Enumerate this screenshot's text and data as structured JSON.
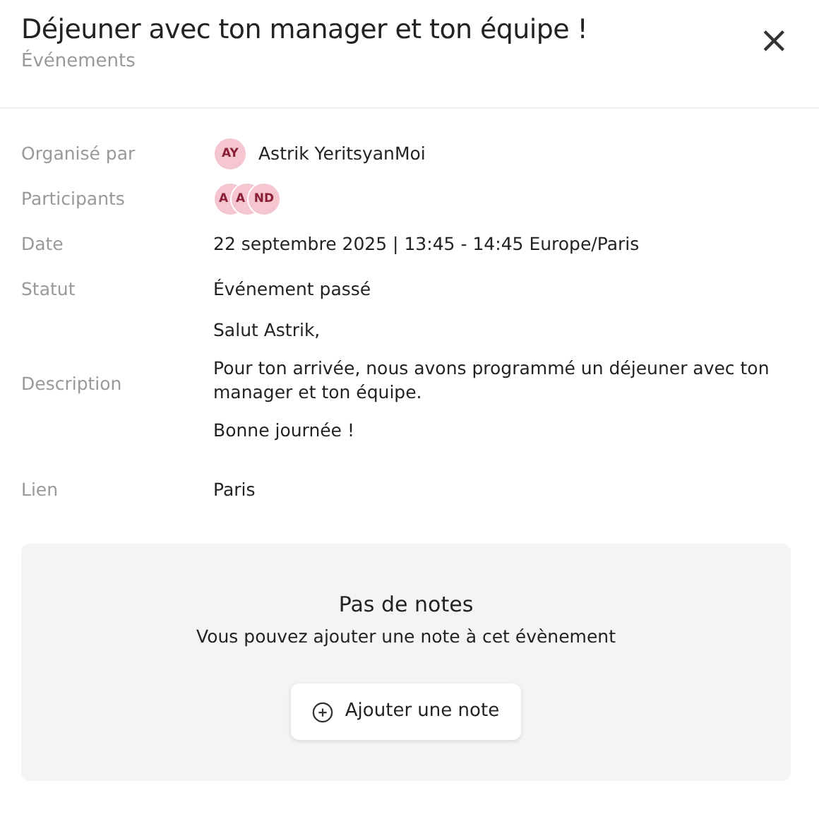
{
  "header": {
    "title": "Déjeuner avec ton manager et ton équipe !",
    "subtitle": "Événements",
    "close": "×"
  },
  "details": [
    {
      "kind": "person",
      "label": "Organisé par",
      "initials": "AY",
      "value": "Astrik YeritsyanMoi"
    },
    {
      "kind": "avatars",
      "label": "Participants",
      "avatars": [
        "A",
        "A",
        "ND"
      ]
    },
    {
      "kind": "text",
      "label": "Date",
      "value": "22 septembre 2025 | 13:45 - 14:45 Europe/Paris"
    },
    {
      "kind": "text",
      "label": "Statut",
      "value": "Événement passé"
    },
    {
      "kind": "paragraphs",
      "label": "Description",
      "paragraphs": [
        "Salut Astrik,",
        "Pour ton arrivée, nous avons programmé un déjeuner avec ton manager et ton équipe.",
        "Bonne journée !"
      ]
    },
    {
      "kind": "text",
      "label": "Lien",
      "value": "Paris"
    }
  ],
  "notes": {
    "title": "Pas de notes",
    "message": "Vous pouvez ajouter une note à cet évènement",
    "button": "Ajouter une note"
  }
}
